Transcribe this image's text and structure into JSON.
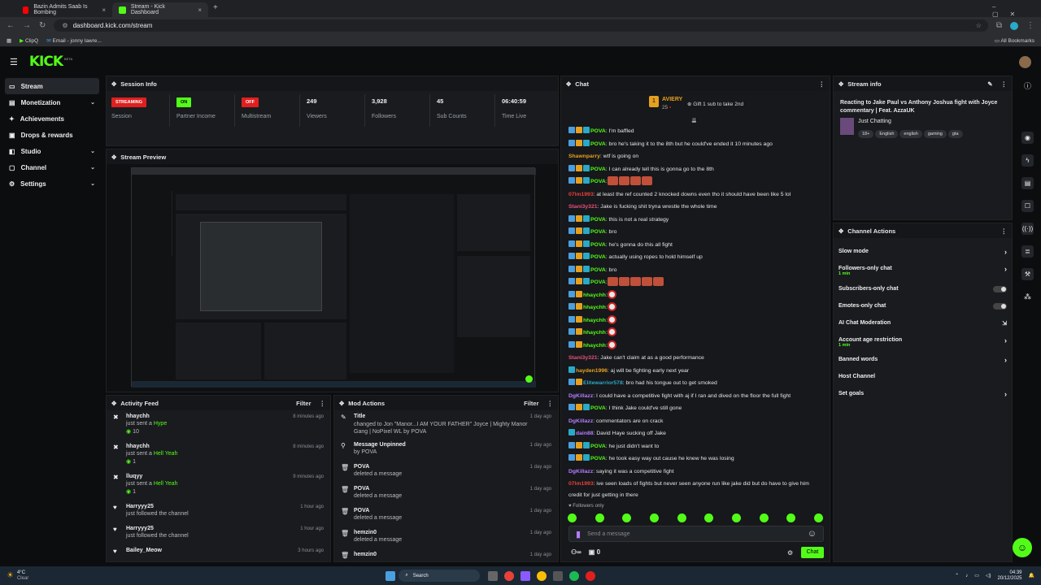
{
  "browser": {
    "tabs": [
      {
        "title": "Bazin Admits Saab Is Bombing",
        "close": "×"
      },
      {
        "title": "Stream - Kick Dashboard",
        "close": "×"
      }
    ],
    "new_tab": "+",
    "url": "dashboard.kick.com/stream",
    "bookmarks": [
      "ClipQ",
      "Email - jonny lawre..."
    ],
    "all_bookmarks": "All Bookmarks"
  },
  "app": {
    "logo": "KICK",
    "logo_sup": "BETA"
  },
  "sidebar": {
    "items": [
      {
        "label": "Stream",
        "chev": ""
      },
      {
        "label": "Monetization",
        "chev": "⌄"
      },
      {
        "label": "Achievements",
        "chev": ""
      },
      {
        "label": "Drops & rewards",
        "chev": ""
      },
      {
        "label": "Studio",
        "chev": "⌄"
      },
      {
        "label": "Channel",
        "chev": "⌄"
      },
      {
        "label": "Settings",
        "chev": "⌄"
      }
    ]
  },
  "session": {
    "title": "Session Info",
    "stats": [
      {
        "value": "STREAMING",
        "label": "Session"
      },
      {
        "value": "ON",
        "label": "Partner Income"
      },
      {
        "value": "OFF",
        "label": "Multistream"
      },
      {
        "value": "249",
        "label": "Viewers"
      },
      {
        "value": "3,928",
        "label": "Followers"
      },
      {
        "value": "45",
        "label": "Sub Counts"
      },
      {
        "value": "06:40:59",
        "label": "Time Live"
      }
    ]
  },
  "preview": {
    "title": "Stream Preview"
  },
  "activity": {
    "title": "Activity Feed",
    "filter": "Filter",
    "rows": [
      {
        "name": "hhaychh",
        "action": "just sent a",
        "item": "Hype",
        "count": "10",
        "time": "8 minutes ago"
      },
      {
        "name": "hhaychh",
        "action": "just sent a",
        "item": "Hell Yeah",
        "count": "1",
        "time": "8 minutes ago"
      },
      {
        "name": "lluqyy",
        "action": "just sent a",
        "item": "Hell Yeah",
        "count": "1",
        "time": "9 minutes ago"
      },
      {
        "name": "Harryyy25",
        "action": "just followed the channel",
        "item": "",
        "count": "",
        "time": "1 hour ago"
      },
      {
        "name": "Harryyy25",
        "action": "just followed the channel",
        "item": "",
        "count": "",
        "time": "1 hour ago"
      },
      {
        "name": "Bailey_Meow",
        "action": "",
        "item": "",
        "count": "",
        "time": "3 hours ago"
      }
    ]
  },
  "mod": {
    "title": "Mod Actions",
    "filter": "Filter",
    "rows": [
      {
        "name": "Title",
        "detail": "changed to Jon \"Manor...I AM YOUR FATHER\" Joyce | Mighty Manor Gang | NoPixel WL by POVA",
        "time": "1 day ago"
      },
      {
        "name": "Message Unpinned",
        "detail": "by POVA",
        "time": "1 day ago"
      },
      {
        "name": "POVA",
        "detail": "deleted a message",
        "time": "1 day ago"
      },
      {
        "name": "POVA",
        "detail": "deleted a message",
        "time": "1 day ago"
      },
      {
        "name": "POVA",
        "detail": "deleted a message",
        "time": "1 day ago"
      },
      {
        "name": "hemzin0",
        "detail": "deleted a message",
        "time": "1 day ago"
      },
      {
        "name": "hemzin0",
        "detail": "",
        "time": "1 day ago"
      }
    ]
  },
  "chat": {
    "title": "Chat",
    "gifter": "AVIERY",
    "gifter_count": "25",
    "gift_text": "Gift 1 sub to take 2nd",
    "lines": [
      {
        "user": "POVA",
        "color": "#53fc18",
        "text": ": I'm baffled",
        "badges": 3,
        "emotes": 0
      },
      {
        "user": "POVA",
        "color": "#53fc18",
        "text": ": bro he's taking it to the 8th but he could've ended it 10 minutes ago",
        "badges": 3,
        "emotes": 0
      },
      {
        "user": "Shawnparry",
        "color": "#e6a020",
        "text": ": wtf is going on",
        "badges": 0,
        "emotes": 0
      },
      {
        "user": "POVA",
        "color": "#53fc18",
        "text": ": I can already tell this is gonna go to the 8th",
        "badges": 3,
        "emotes": 0
      },
      {
        "user": "POVA",
        "color": "#53fc18",
        "text": ":",
        "badges": 3,
        "emotes": 4
      },
      {
        "user": "07lm1993",
        "color": "#e8413a",
        "text": ": at least the ref counted 2 knocked downs even tho it should have been like 5 lol",
        "badges": 0,
        "emotes": 0
      },
      {
        "user": "Stani3y321",
        "color": "#e8507a",
        "text": ": Jake is fucking shit tryna wrestle the whole time",
        "badges": 0,
        "emotes": 0
      },
      {
        "user": "POVA",
        "color": "#53fc18",
        "text": ": this is not a real strategy",
        "badges": 3,
        "emotes": 0
      },
      {
        "user": "POVA",
        "color": "#53fc18",
        "text": ": bro",
        "badges": 3,
        "emotes": 0
      },
      {
        "user": "POVA",
        "color": "#53fc18",
        "text": ": he's gonna do this all fight",
        "badges": 3,
        "emotes": 0
      },
      {
        "user": "POVA",
        "color": "#53fc18",
        "text": ": actually using ropes to hold himself up",
        "badges": 3,
        "emotes": 0
      },
      {
        "user": "POVA",
        "color": "#53fc18",
        "text": ": bro",
        "badges": 3,
        "emotes": 0
      },
      {
        "user": "POVA",
        "color": "#53fc18",
        "text": ":",
        "badges": 3,
        "emotes": 5
      },
      {
        "user": "hhaychh",
        "color": "#53fc18",
        "text": ":",
        "badges": 2,
        "emotes": -1
      },
      {
        "user": "hhaychh",
        "color": "#53fc18",
        "text": ":",
        "badges": 2,
        "emotes": -1
      },
      {
        "user": "hhaychh",
        "color": "#53fc18",
        "text": ":",
        "badges": 2,
        "emotes": -1
      },
      {
        "user": "hhaychh",
        "color": "#53fc18",
        "text": ":",
        "badges": 2,
        "emotes": -1
      },
      {
        "user": "hhaychh",
        "color": "#53fc18",
        "text": ":",
        "badges": 2,
        "emotes": -1
      },
      {
        "user": "Stani3y321",
        "color": "#e8507a",
        "text": ": Jake can't claim at as a good performance",
        "badges": 0,
        "emotes": 0
      },
      {
        "user": "hayden1996",
        "color": "#e6a020",
        "text": ": aj will be fighting early next year",
        "badges": 1,
        "emotes": 0
      },
      {
        "user": "Elitewarrior578",
        "color": "#2aa9c9",
        "text": ": bro had his tongue out to get smoked",
        "badges": 2,
        "emotes": 0
      },
      {
        "user": "DgKillazz",
        "color": "#b57cff",
        "text": ": I could have a competitive fight with aj if I ran and dived on the floor the full fight",
        "badges": 0,
        "emotes": 0
      },
      {
        "user": "POVA",
        "color": "#53fc18",
        "text": ": I think Jake could've still gone",
        "badges": 3,
        "emotes": 0
      },
      {
        "user": "DgKillazz",
        "color": "#b57cff",
        "text": ": commentators are on crack",
        "badges": 0,
        "emotes": 0
      },
      {
        "user": "dain88",
        "color": "#b57cff",
        "text": ": David Haye sucking off Jake",
        "badges": 1,
        "emotes": 0
      },
      {
        "user": "POVA",
        "color": "#53fc18",
        "text": ": he just didn't want to",
        "badges": 3,
        "emotes": 0
      },
      {
        "user": "POVA",
        "color": "#53fc18",
        "text": ": he took easy way out cause he knew he was losing",
        "badges": 3,
        "emotes": 0
      },
      {
        "user": "DgKillazz",
        "color": "#b57cff",
        "text": ": saying it was a competitive fight",
        "badges": 0,
        "emotes": 0
      },
      {
        "user": "07lm1993",
        "color": "#e8413a",
        "text": ": ive seen loads of fights but never seen anyone run like jake did but do have to give him",
        "badges": 0,
        "emotes": 0
      }
    ],
    "last_line_cont": "credit for just getting in there",
    "followers_only": "Followers only",
    "placeholder": "Send a message",
    "count_left": "∞",
    "count_right": "0",
    "send": "Chat"
  },
  "stream_info": {
    "title": "Stream info",
    "stream_title": "Reacting to Jake Paul vs Anthony Joshua fight with Joyce commentary | Feat. AzzaUK",
    "category": "Just Chatting",
    "tags": [
      "18+",
      "English",
      "english",
      "gaming",
      "gta"
    ]
  },
  "channel_actions": {
    "title": "Channel Actions",
    "rows": [
      {
        "label": "Slow mode",
        "sub": "",
        "ctl": "chev"
      },
      {
        "label": "Followers-only chat",
        "sub": "1 min",
        "ctl": "chev"
      },
      {
        "label": "Subscribers-only chat",
        "sub": "",
        "ctl": "toggle"
      },
      {
        "label": "Emotes-only chat",
        "sub": "",
        "ctl": "toggle"
      },
      {
        "label": "AI Chat Moderation",
        "sub": "",
        "ctl": "ext"
      },
      {
        "label": "Account age restriction",
        "sub": "1 min",
        "ctl": "chev"
      },
      {
        "label": "Banned words",
        "sub": "",
        "ctl": "chev"
      },
      {
        "label": "Host Channel",
        "sub": "",
        "ctl": "none"
      },
      {
        "label": "Set goals",
        "sub": "",
        "ctl": "chev"
      }
    ]
  },
  "taskbar": {
    "weather_temp": "4°C",
    "weather_desc": "Clear",
    "search": "Search",
    "time": "04:39",
    "date": "20/12/2025"
  },
  "colors": {
    "accent": "#53fc18",
    "live": "#e01f1f"
  }
}
